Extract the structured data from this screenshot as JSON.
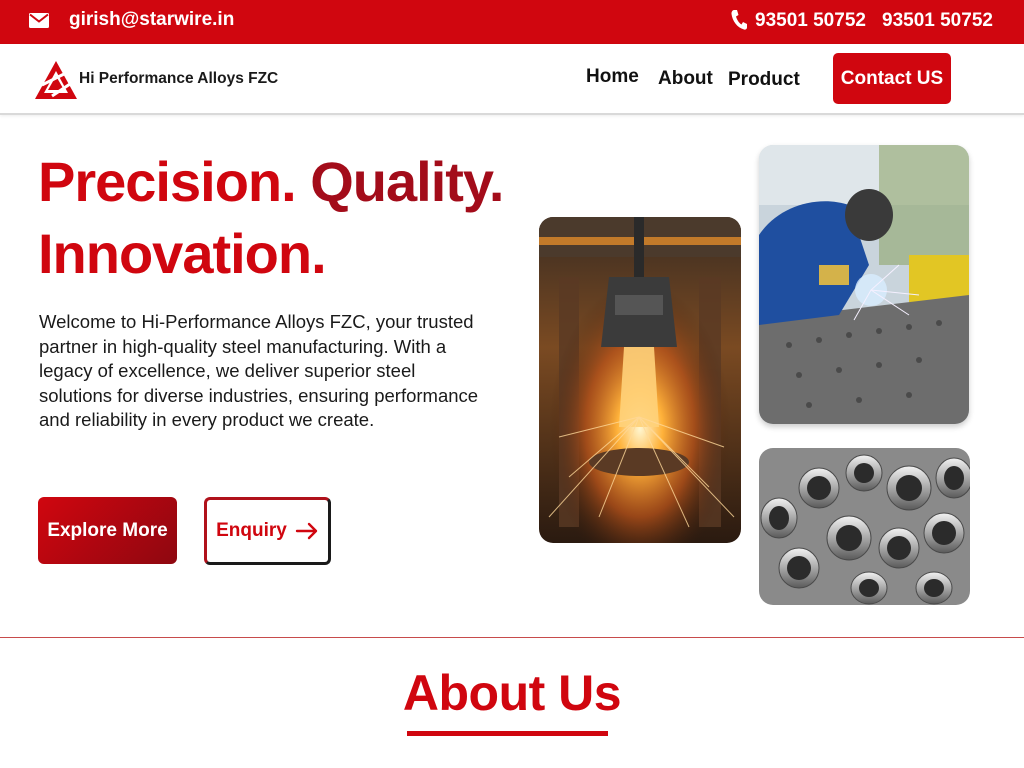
{
  "topbar": {
    "email": "girish@starwire.in",
    "phone_1": "93501 50752",
    "phone_2": "93501 50752",
    "icons": [
      "mail-icon",
      "phone-icon"
    ],
    "background": "#d0060f"
  },
  "nav": {
    "brand": "Hi Performance Alloys FZC",
    "links": [
      "Home",
      "About",
      "Product"
    ],
    "cta": "Contact US"
  },
  "hero": {
    "title_line1_a": "Precision.",
    "title_line1_b": "Quality.",
    "title_line2": "Innovation.",
    "description": "Welcome to Hi-Performance Alloys FZC, your trusted partner in high-quality steel manufacturing. With a legacy of excellence, we deliver superior steel solutions for diverse industries, ensuring performance and reliability in every product we create.",
    "explore_button": "Explore More",
    "enquiry_button": "Enquiry"
  },
  "gallery": [
    "molten-steel-pour-photo",
    "welder-photo",
    "steel-pipes-photo"
  ],
  "about": {
    "title": "About Us"
  },
  "colors": {
    "accent": "#d0060f",
    "accent_dark": "#a30c1a"
  }
}
